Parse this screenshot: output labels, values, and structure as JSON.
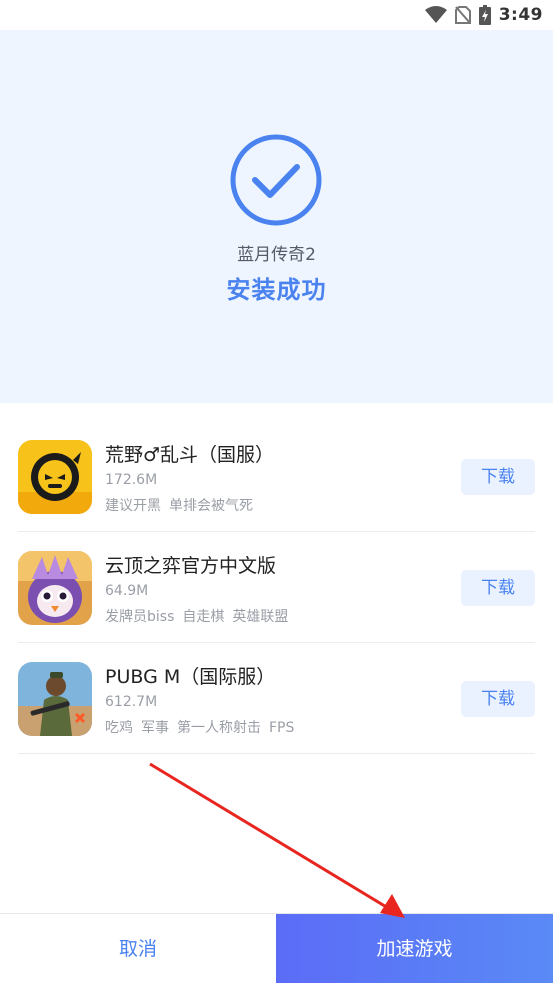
{
  "status_bar": {
    "time": "3:49"
  },
  "install": {
    "app_name": "蓝月传奇2",
    "status": "安装成功"
  },
  "recommendations": [
    {
      "title": "荒野♂乱斗（国服）",
      "size": "172.6M",
      "tags": [
        "建议开黑",
        "单排会被气死"
      ],
      "button": "下载",
      "icon": "brawl-stars-game-icon"
    },
    {
      "title": "云顶之弈官方中文版",
      "size": "64.9M",
      "tags": [
        "发牌员biss",
        "自走棋",
        "英雄联盟"
      ],
      "button": "下载",
      "icon": "teamfight-tactics-game-icon"
    },
    {
      "title": "PUBG M（国际服）",
      "size": "612.7M",
      "tags": [
        "吃鸡",
        "军事",
        "第一人称射击",
        "FPS"
      ],
      "button": "下载",
      "icon": "pubg-mobile-game-icon"
    }
  ],
  "bottom_bar": {
    "cancel": "取消",
    "accelerate": "加速游戏"
  },
  "colors": {
    "accent": "#4a82f0",
    "hero_bg": "#eef5ff",
    "annotation_arrow": "#e8261f"
  }
}
